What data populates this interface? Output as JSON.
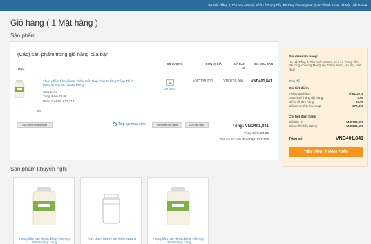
{
  "topbar": {
    "address": "Hà Nội - Tầng 3, Tòa nhà Artemis, số 3 Lê Trọng Tấn, Phường Khương Mai Quận Thanh Xuân, Hà Nội, Việt Nam ▾"
  },
  "page": {
    "title": "Giỏ hàng ( 1 Mặt hàng )",
    "section_products": "Sản phẩm",
    "section_recommended": "Sản phẩm khuyến nghị"
  },
  "cart": {
    "heading": "(Các) sản phẩm trong giỏ hàng của bạn",
    "columns": {
      "item": "MỤC",
      "qty": "SỐ LƯỢNG",
      "unit": "ĐƠN VỊ GIÁ",
      "retail": "GIÁ BÁN LẺ",
      "total": "GIÁ CỦA BẠN"
    },
    "item": {
      "name": "Thực phẩm bảo vệ sức khỏe: Hỗn Hợp Dinh Dưỡng Công Thức 1 (Shake) French Vanilla 550 g",
      "sku": "SKU 0143",
      "volume_points": "Tổng điểm 23.95",
      "base_price": "Điểm cơ bản: 672,318",
      "edit_label": "Bỏ",
      "quantity": "1",
      "remove_label": "Gỡ nhớt",
      "unit_price": "VND738,000",
      "retail_price": "VND738,000",
      "your_price": "VND401,841"
    },
    "buttons": {
      "clear": "Xóa thông tin giỏ hàng",
      "continue": "Tiếp tục mua sắm",
      "save_template": "Giới thiệu giỏ hàng",
      "save_cart": "Lưu giỏ hàng"
    },
    "totals": {
      "total": "Tổng: VND401,841",
      "points": "Tổng điểm 23.95",
      "tax_base": "Giá cơ sở tính thu nhập: 672,318"
    }
  },
  "summary": {
    "pickup_heading": "Địa điểm lấy hàng:",
    "pickup_address": "Hà Nội Tầng 3, Tòa nhà Artemis, số 3 Lê Trọng Tấn, Phường Khương Mai Quận Thanh Xuân, Hà Nội, Việt Nam",
    "change_link": "Thay đổi",
    "points_heading": "Chi tiết điểm",
    "points_rows": [
      {
        "label": "Tháng đặt hàng:",
        "value": "Thg1 2019"
      },
      {
        "label": "Doanh số tháng đặt hàng:",
        "value": "0.00"
      },
      {
        "label": "Điểm số đơn hàng:",
        "value": "23.95"
      },
      {
        "label": "Giá cơ sở tính thu nhập:",
        "value": "672,318"
      }
    ],
    "order_heading": "Chi tiết đơn hàng",
    "order_rows": [
      {
        "label": "Giá bán lẻ:",
        "value": "VND738,000"
      },
      {
        "label": "Giá chiết khấu (50%)",
        "value": "- VND336,159"
      }
    ],
    "total_label": "Tổng số:",
    "total_value": "VND401,841",
    "checkout_label": "TIẾN HÀNH THANH TOÁN"
  },
  "recommended": [
    {
      "name": "Thực phẩm bảo vệ sức khỏe: Hỗn Hợp Dinh Dưỡng Công"
    },
    {
      "name": "Thực phẩm bảo vệ sức khỏe: Natural"
    },
    {
      "name": "Thực phẩm bảo vệ sức khỏe: Hỗn Hợp Dinh Dưỡng Công"
    }
  ]
}
